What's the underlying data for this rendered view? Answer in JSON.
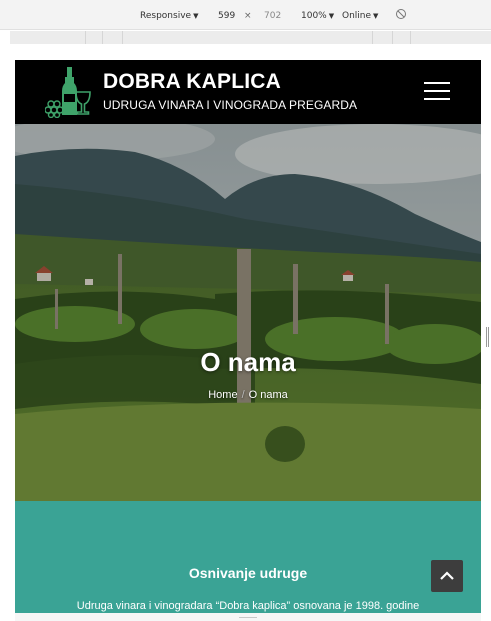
{
  "devtools": {
    "device": "Responsive",
    "width": "599",
    "times": "×",
    "height": "702",
    "zoom": "100%",
    "throttle": "Online"
  },
  "header": {
    "title": "DOBRA KAPLICA",
    "tagline": "UDRUGA VINARA I VINOGRADA PREGARDA"
  },
  "hero": {
    "title": "O nama",
    "breadcrumb": {
      "home": "Home",
      "separator": "/",
      "current": "O nama"
    }
  },
  "about": {
    "heading": "Osnivanje udruge",
    "text": "Udruga vinara i vinogradara “Dobra kaplica” osnovana je 1998. godine"
  },
  "colors": {
    "header_bg": "#000000",
    "accent_teal": "#3aa395",
    "logo_green": "#3fa36a",
    "to_top_bg": "#3d3d3d"
  },
  "icons": {
    "menu": "hamburger-icon",
    "to_top": "chevron-up-icon",
    "logo": "wine-bottle-glass-grapes-icon",
    "rotate": "rotate-icon"
  }
}
